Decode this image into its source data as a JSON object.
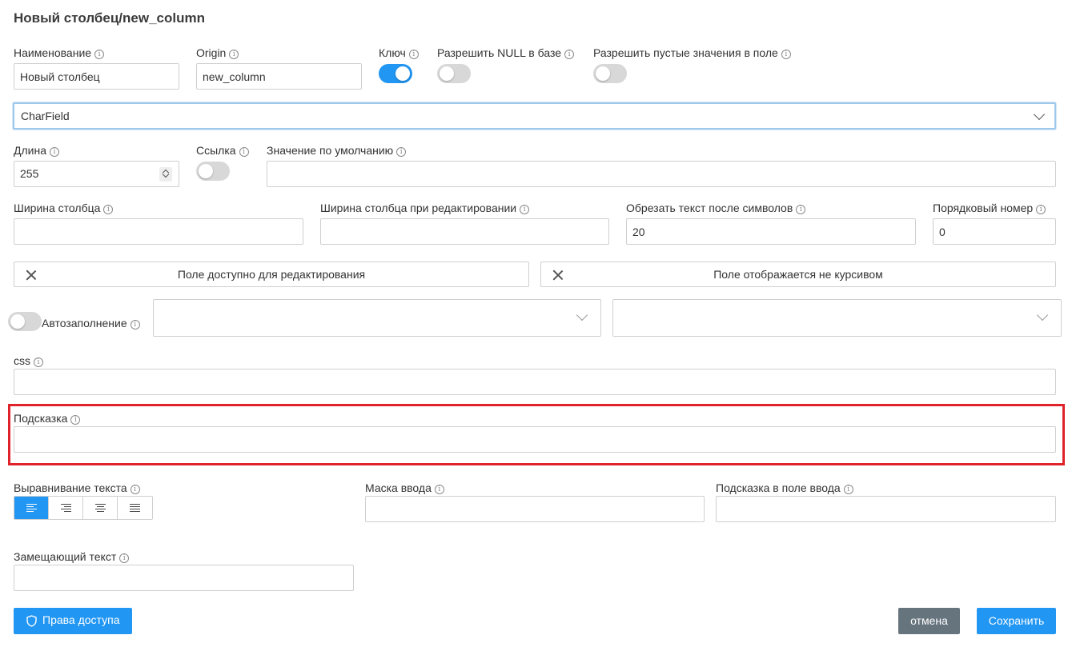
{
  "title": "Новый столбец/new_column",
  "info_glyph": "i",
  "fields": {
    "name": {
      "label": "Наименование",
      "value": "Новый столбец"
    },
    "origin": {
      "label": "Origin",
      "value": "new_column"
    },
    "key": {
      "label": "Ключ",
      "on": true
    },
    "allow_null": {
      "label": "Разрешить NULL в базе",
      "on": false
    },
    "allow_empty": {
      "label": "Разрешить пустые значения в поле",
      "on": false
    },
    "field_type": {
      "selected": "CharField"
    },
    "length": {
      "label": "Длина",
      "value": "255"
    },
    "link": {
      "label": "Ссылка",
      "on": false
    },
    "default_value": {
      "label": "Значение по умолчанию",
      "value": ""
    },
    "column_width": {
      "label": "Ширина столбца",
      "value": ""
    },
    "edit_width": {
      "label": "Ширина столбца при редактировании",
      "value": ""
    },
    "truncate": {
      "label": "Обрезать текст после символов",
      "value": "20"
    },
    "order": {
      "label": "Порядковый номер",
      "value": "0"
    },
    "editable_toggle": {
      "label": "Поле доступно для редактирования"
    },
    "italic_toggle": {
      "label": "Поле отображается не курсивом"
    },
    "autofill": {
      "label": "Автозаполнение",
      "on": false
    },
    "css": {
      "label": "css",
      "value": ""
    },
    "hint": {
      "label": "Подсказка",
      "value": ""
    },
    "text_align": {
      "label": "Выравнивание текста",
      "options": [
        "left",
        "right",
        "center",
        "justify"
      ],
      "selected": "left"
    },
    "input_mask": {
      "label": "Маска ввода",
      "value": ""
    },
    "input_placeholder": {
      "label": "Подсказка в поле ввода",
      "value": ""
    },
    "alt_text": {
      "label": "Замещающий текст",
      "value": ""
    }
  },
  "buttons": {
    "access": "Права доступа",
    "cancel": "отмена",
    "save": "Сохранить"
  },
  "colors": {
    "accent": "#2196f3",
    "cancel_bg": "#66747e",
    "highlight": "#e0232b"
  },
  "icons": {
    "info": "info-circle-icon",
    "close": "close-icon",
    "chevron": "chevron-down-icon",
    "shield": "shield-icon"
  }
}
